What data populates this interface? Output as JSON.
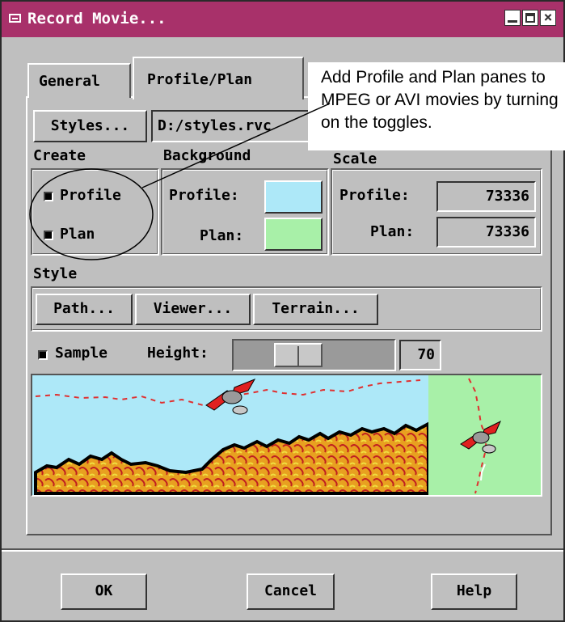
{
  "window": {
    "title": "Record Movie..."
  },
  "tabs": [
    {
      "label": "General",
      "active": false
    },
    {
      "label": "Profile/Plan",
      "active": true
    }
  ],
  "styles": {
    "button_label": "Styles...",
    "path_value": "D:/styles.rvc"
  },
  "create": {
    "heading": "Create",
    "profile_label": "Profile",
    "profile_checked": true,
    "plan_label": "Plan",
    "plan_checked": true
  },
  "background": {
    "heading": "Background",
    "profile_label": "Profile:",
    "profile_color": "#ade8f8",
    "plan_label": "Plan:",
    "plan_color": "#a8f0a8"
  },
  "scale": {
    "heading": "Scale",
    "profile_label": "Profile:",
    "profile_value": "73336",
    "plan_label": "Plan:",
    "plan_value": "73336"
  },
  "style": {
    "heading": "Style",
    "path_button": "Path...",
    "viewer_button": "Viewer...",
    "terrain_button": "Terrain..."
  },
  "sample": {
    "label": "Sample",
    "checked": true,
    "height_label": "Height:",
    "height_value": "70",
    "height_fraction": 0.35
  },
  "buttons": {
    "ok": "OK",
    "cancel": "Cancel",
    "help": "Help"
  },
  "callout": {
    "text": "Add Profile and Plan panes to MPEG or AVI movies by turning on the toggles."
  },
  "colors": {
    "title_bar": "#a8316a",
    "panel": "#bfbfbf",
    "sky": "#ade8f8",
    "plan_bg": "#a8f0a8",
    "terrain_fill": "#e8a020",
    "path_line": "#e03030"
  }
}
